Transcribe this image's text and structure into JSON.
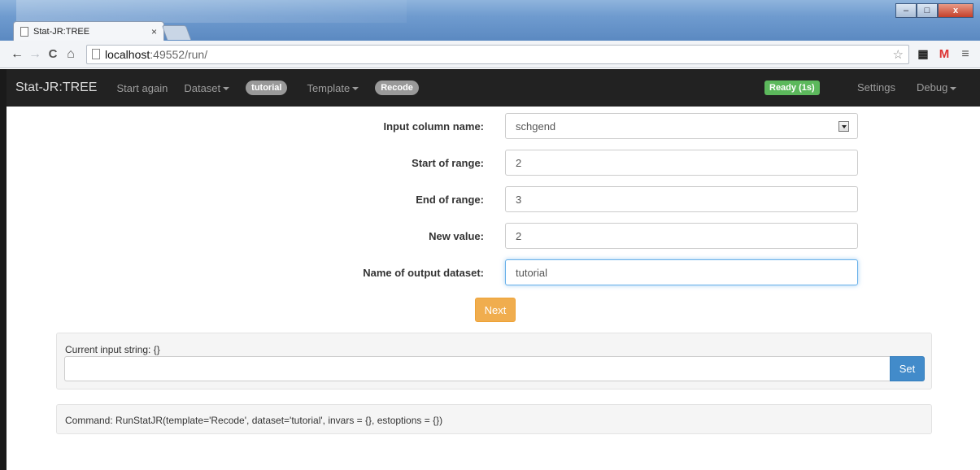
{
  "browser": {
    "tab_title": "Stat-JR:TREE",
    "tab_close": "×",
    "url_host": "localhost",
    "url_rest": ":49552/run/",
    "window_buttons": {
      "minimize": "–",
      "maximize": "□",
      "close": "x"
    }
  },
  "navbar": {
    "brand": "Stat-JR:TREE",
    "start_again": "Start again",
    "dataset": "Dataset",
    "dataset_badge": "tutorial",
    "template": "Template",
    "template_badge": "Recode",
    "status": "Ready (1s)",
    "settings": "Settings",
    "debug": "Debug"
  },
  "form": {
    "fields": [
      {
        "label": "Input column name:",
        "value": "schgend",
        "type": "select"
      },
      {
        "label": "Start of range:",
        "value": "2",
        "type": "text"
      },
      {
        "label": "End of range:",
        "value": "3",
        "type": "text"
      },
      {
        "label": "New value:",
        "value": "2",
        "type": "text"
      },
      {
        "label": "Name of output dataset:",
        "value": "tutorial",
        "type": "text"
      }
    ],
    "next_label": "Next"
  },
  "input_string": {
    "label": "Current input string: {}",
    "value": "",
    "set_label": "Set"
  },
  "command": {
    "text": "Command: RunStatJR(template='Recode', dataset='tutorial', invars = {}, estoptions = {})"
  },
  "colors": {
    "navbar_bg": "#222222",
    "ready_green": "#5cb85c",
    "next_orange": "#f0ad4e",
    "set_blue": "#428bca"
  }
}
